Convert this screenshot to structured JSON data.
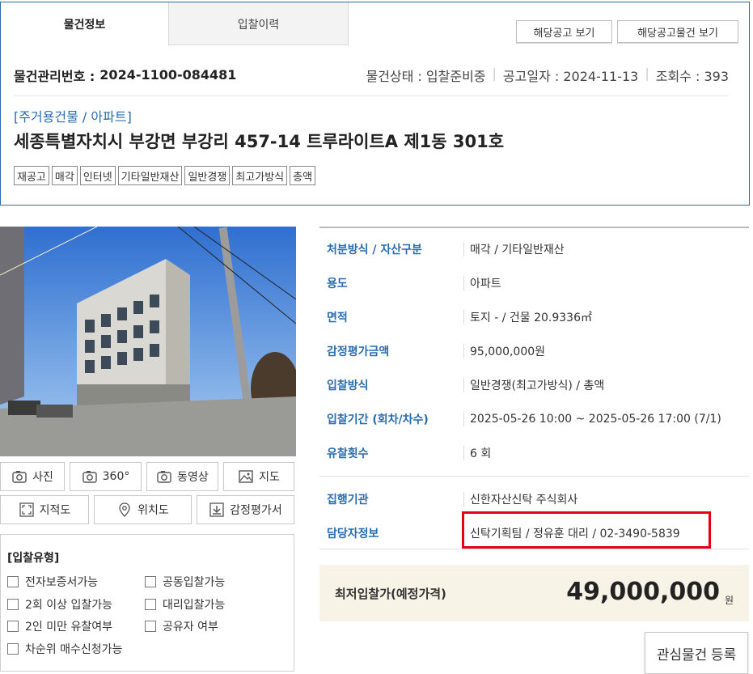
{
  "tabs": [
    {
      "label": "물건정보",
      "active": true
    },
    {
      "label": "입찰이력",
      "active": false
    }
  ],
  "header_buttons": {
    "notice": "해당공고 보기",
    "notice_items": "해당공고물건 보기"
  },
  "item": {
    "mgmt_label": "물건관리번호 :",
    "mgmt_number": "2024-1100-084481",
    "status": "물건상태 : 입찰준비중",
    "notice_date": "공고일자 : 2024-11-13",
    "views": "조회수 : 393",
    "category": "[주거용건물 / 아파트]",
    "address": "세종특별자치시 부강면 부강리 457-14 트루라이트A 제1동 301호",
    "tags": [
      "재공고",
      "매각",
      "인터넷",
      "기타일반재산",
      "일반경쟁",
      "최고가방식",
      "총액"
    ]
  },
  "media_buttons": [
    {
      "label": "사진",
      "icon": "camera-icon"
    },
    {
      "label": "360°",
      "icon": "camera-icon"
    },
    {
      "label": "동영상",
      "icon": "camera-icon"
    },
    {
      "label": "지도",
      "icon": "picture-icon"
    },
    {
      "label": "지적도",
      "icon": "expand-icon"
    },
    {
      "label": "위치도",
      "icon": "location-pin-icon"
    },
    {
      "label": "감정평가서",
      "icon": "download-icon"
    }
  ],
  "bid_type": {
    "title": "[입찰유형]",
    "options": [
      {
        "label": "전자보증서가능",
        "checked": false
      },
      {
        "label": "공동입찰가능",
        "checked": false
      },
      {
        "label": "2회 이상 입찰가능",
        "checked": false
      },
      {
        "label": "대리입찰가능",
        "checked": false
      },
      {
        "label": "2인 미만 유찰여부",
        "checked": false
      },
      {
        "label": "공유자 여부",
        "checked": false
      },
      {
        "label": "차순위 매수신청가능",
        "checked": false
      }
    ]
  },
  "info": [
    {
      "key": "처분방식 / 자산구분",
      "value": "매각 / 기타일반재산"
    },
    {
      "key": "용도",
      "value": "아파트"
    },
    {
      "key": "면적",
      "value": "토지 - / 건물 20.9336㎡"
    },
    {
      "key": "감정평가금액",
      "value": "95,000,000원"
    },
    {
      "key": "입찰방식",
      "value": "일반경쟁(최고가방식) / 총액"
    },
    {
      "key": "입찰기간 (회차/차수)",
      "value": "2025-05-26 10:00 ~ 2025-05-26 17:00 (7/1)"
    },
    {
      "key": "유찰횟수",
      "value": "6 회"
    },
    {
      "key": "집행기관",
      "value": "신한자산신탁 주식회사"
    },
    {
      "key": "담당자정보",
      "value": "신탁기획팀 / 정유훈 대리 / 02-3490-5839"
    }
  ],
  "min_price": {
    "label": "최저입찰가(예정가격)",
    "value": "49,000,000",
    "unit": "원"
  },
  "favorite_button": "관심물건 등록",
  "colors": {
    "accent_blue": "#2a6cb0",
    "highlight_red": "#e60012",
    "price_bg": "#f7f3e6"
  }
}
